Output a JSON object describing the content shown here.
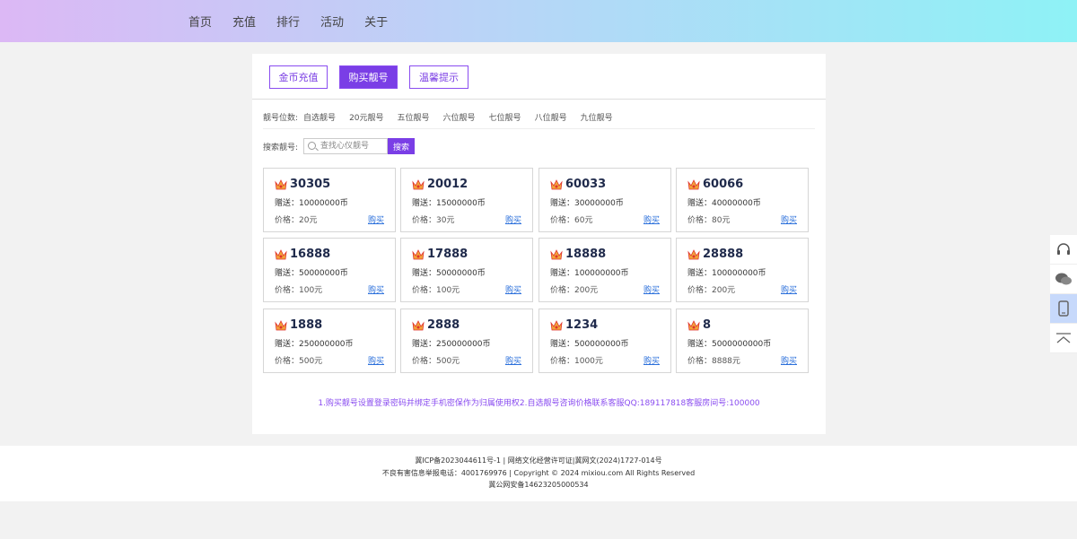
{
  "nav": [
    "首页",
    "充值",
    "排行",
    "活动",
    "关于"
  ],
  "tabs": [
    "金币充值",
    "购买靓号",
    "温馨提示"
  ],
  "filter": {
    "label": "靓号位数:",
    "options": [
      "自选靓号",
      "20元靓号",
      "五位靓号",
      "六位靓号",
      "七位靓号",
      "八位靓号",
      "九位靓号"
    ]
  },
  "search": {
    "label": "搜索靓号:",
    "placeholder": "查找心仪靓号",
    "button": "搜索"
  },
  "cards": [
    {
      "number": "30305",
      "gift": "赠送：10000000币",
      "price": "价格：20元",
      "buy": "购买"
    },
    {
      "number": "20012",
      "gift": "赠送：15000000币",
      "price": "价格：30元",
      "buy": "购买"
    },
    {
      "number": "60033",
      "gift": "赠送：30000000币",
      "price": "价格：60元",
      "buy": "购买"
    },
    {
      "number": "60066",
      "gift": "赠送：40000000币",
      "price": "价格：80元",
      "buy": "购买"
    },
    {
      "number": "16888",
      "gift": "赠送：50000000币",
      "price": "价格：100元",
      "buy": "购买"
    },
    {
      "number": "17888",
      "gift": "赠送：50000000币",
      "price": "价格：100元",
      "buy": "购买"
    },
    {
      "number": "18888",
      "gift": "赠送：100000000币",
      "price": "价格：200元",
      "buy": "购买"
    },
    {
      "number": "28888",
      "gift": "赠送：100000000币",
      "price": "价格：200元",
      "buy": "购买"
    },
    {
      "number": "1888",
      "gift": "赠送：250000000币",
      "price": "价格：500元",
      "buy": "购买"
    },
    {
      "number": "2888",
      "gift": "赠送：250000000币",
      "price": "价格：500元",
      "buy": "购买"
    },
    {
      "number": "1234",
      "gift": "赠送：500000000币",
      "price": "价格：1000元",
      "buy": "购买"
    },
    {
      "number": "8",
      "gift": "赠送：5000000000币",
      "price": "价格：8888元",
      "buy": "购买"
    }
  ],
  "notice": "1.购买靓号设置登录密码并绑定手机密保作为归属使用权2.自选靓号咨询价格联系客服QQ:189117818客服房间号:100000",
  "footer": [
    "冀ICP备2023044611号-1 | 网络文化经营许可证|冀网文(2024)1727-014号",
    "不良有害信息举报电话：4001769976 | Copyright © 2024 mixiou.com All Rights Reserved",
    "冀公网安备14623205000534"
  ],
  "side_icons": [
    "headset-icon",
    "wechat-icon",
    "phone-icon",
    "back-to-top-icon"
  ],
  "colors": {
    "accent": "#7a3ee6",
    "link": "#2a6fdb",
    "notice": "#8a4cf0"
  }
}
